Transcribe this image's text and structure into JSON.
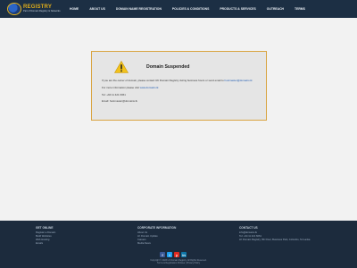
{
  "header": {
    "logo_title": "REGISTRY",
    "logo_sub": "Part of Domain Registry & Networks",
    "nav": [
      "HOME",
      "ABOUT US",
      "DOMAIN NAME REGISTRATION",
      "POLICIES & CONDITIONS",
      "PRODUCTS & SERVICES",
      "OUTREACH",
      "TERMS"
    ]
  },
  "notice": {
    "title": "Domain Suspended",
    "para1_before": "If you are the owner of domain, please contact UK Domain Registry during business hours or send email to ",
    "para1_link": "hostmaster@domains.lk",
    "para2_before": "For more information please visit ",
    "para2_link": "www.domains.lk",
    "tel": "Tel: +94 11 421 6061",
    "email": "Email: hostmaster@domains.lk"
  },
  "footer": {
    "col1": {
      "heading": "GET ONLINE",
      "links": [
        "Register a Domain",
        "Build Websites",
        "Web Hosting",
        "Emails"
      ]
    },
    "col2": {
      "heading": "CORPORATE INFORMATION",
      "links": [
        "About Us",
        "LK Domain Update",
        "Careers",
        "Media News"
      ]
    },
    "col3": {
      "heading": "CONTACT US",
      "links": [
        "info@domains.lk",
        "Tel: +94 11 421 6061",
        "LK Domain Registry, 5th Floor, Business Park, Colombo, Sri Lanka"
      ]
    },
    "social": [
      "f",
      "t",
      "y",
      "in"
    ],
    "copyright_line1": "Copyright © 2023 LK Domain Registry. All Rights Reserved.",
    "copyright_line2": "Terms & Registration Policies | Privacy Policy"
  },
  "colors": {
    "header_bg": "#1c2f44",
    "footer_bg": "#1c2b3d",
    "card_border": "#d9a441",
    "warning_yellow": "#f2c21b"
  }
}
